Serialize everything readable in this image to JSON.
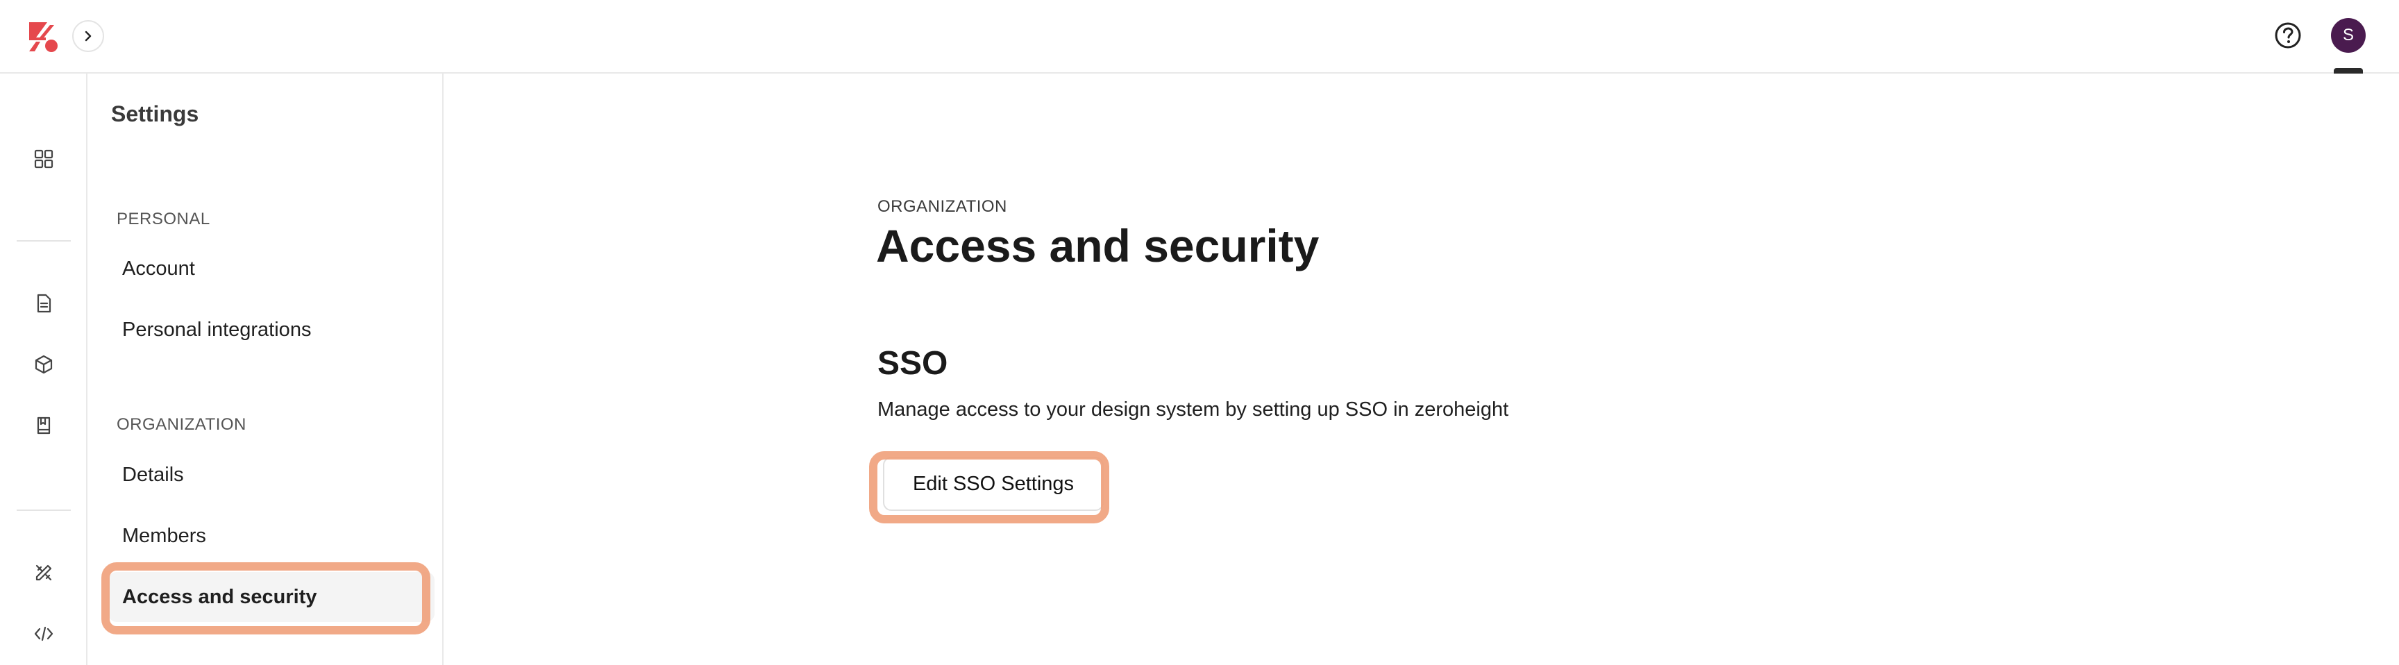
{
  "header": {
    "logo_icon": "zeroheight-logo-icon",
    "collapse_icon": "chevron-right-icon",
    "help_icon": "help-circle-icon",
    "avatar_initial": "S",
    "avatar_color": "#4a1b4f"
  },
  "rail": {
    "icons": [
      "dashboard-grid-icon",
      "document-icon",
      "package-icon",
      "bookmark-book-icon",
      "design-tools-icon",
      "code-icon"
    ]
  },
  "sidebar": {
    "title": "Settings",
    "personal_label": "PERSONAL",
    "personal_items": [
      {
        "label": "Account"
      },
      {
        "label": "Personal integrations"
      }
    ],
    "organization_label": "ORGANIZATION",
    "organization_items": [
      {
        "label": "Details"
      },
      {
        "label": "Members"
      },
      {
        "label": "Access and security",
        "active": true
      }
    ]
  },
  "main": {
    "section_label": "ORGANIZATION",
    "title": "Access and security",
    "sso": {
      "heading": "SSO",
      "description": "Manage access to your design system by setting up SSO in zeroheight",
      "button_label": "Edit SSO Settings"
    }
  },
  "colors": {
    "highlight": "#f0a07a",
    "logo": "#e5484d",
    "active_bg": "#f4f4f4"
  }
}
